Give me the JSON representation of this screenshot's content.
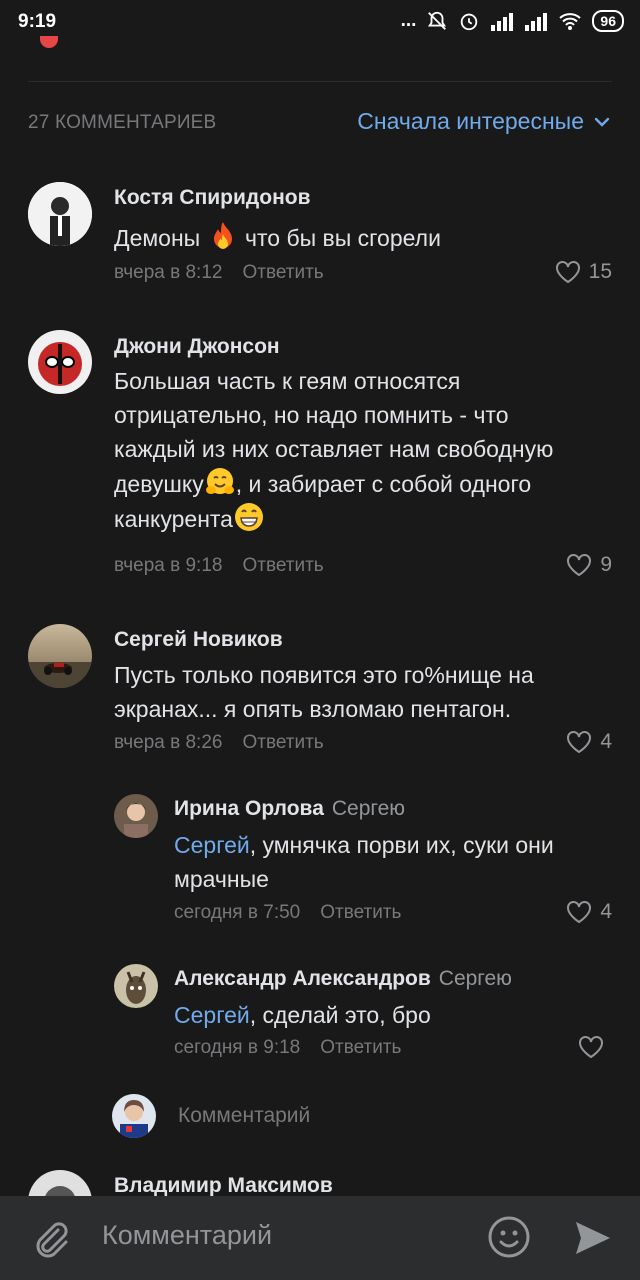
{
  "status_bar": {
    "time": "9:19",
    "dots": "...",
    "battery": "96"
  },
  "comments_header": {
    "count": "27 КОММЕНТАРИЕВ",
    "sort": "Сначала интересные"
  },
  "comments": [
    {
      "author": "Костя Спиридонов",
      "text_before": "Демоны ",
      "text_after": " что бы вы сгорели",
      "time": "вчера в 8:12",
      "reply": "Ответить",
      "likes": "15"
    },
    {
      "author": "Джони Джонсон",
      "text_1": "Большая часть к геям относятся отрицательно, но надо помнить - что каждый из них оставляет нам свободную девушку",
      "text_2": ", и забирает с собой одного канкурента",
      "time": "вчера в 9:18",
      "reply": "Ответить",
      "likes": "9"
    },
    {
      "author": "Сергей Новиков",
      "text": "Пусть только появится это го%нище на экранах... я опять взломаю пентагон.",
      "time": "вчера в 8:26",
      "reply": "Ответить",
      "likes": "4"
    }
  ],
  "replies": [
    {
      "author": "Ирина Орлова",
      "reply_to": "Сергею",
      "mention": "Сергей",
      "text": ", умнячка порви их, суки они мрачные",
      "time": "сегодня в 7:50",
      "reply": "Ответить",
      "likes": "4"
    },
    {
      "author": "Александр Александров",
      "reply_to": "Сергею",
      "mention": "Сергей",
      "text": ", сделай это, бро",
      "time": "сегодня в 9:18",
      "reply": "Ответить",
      "likes": ""
    }
  ],
  "reply_box": {
    "placeholder": "Комментарий"
  },
  "next_comment": {
    "author": "Владимир Максимов"
  },
  "composer": {
    "placeholder": "Комментарий"
  },
  "colors": {
    "background": "#19191a",
    "accent": "#71aaeb",
    "text": "#e1e3e6",
    "secondary": "#76787a",
    "composer_bg": "#2c2d2e"
  },
  "icons": [
    "wifi-icon",
    "signal-icon",
    "alarm-icon",
    "mute-icon",
    "chevron-down-icon",
    "heart-icon",
    "fire-emoji",
    "hug-emoji",
    "grin-emoji",
    "attach-icon",
    "smile-icon",
    "send-icon"
  ]
}
